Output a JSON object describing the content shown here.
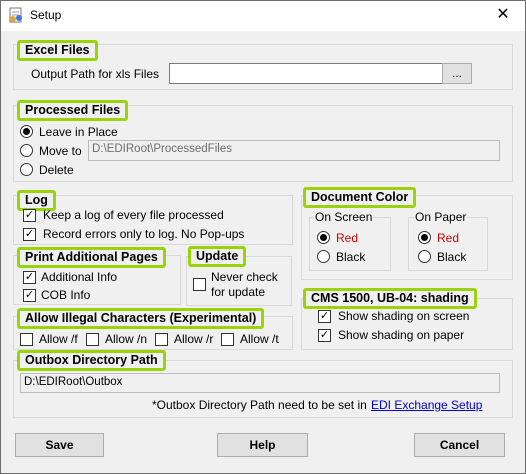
{
  "window": {
    "title": "Setup"
  },
  "excel": {
    "header": "Excel Files",
    "output_label": "Output Path for xls Files",
    "output_value": "",
    "browse_label": "..."
  },
  "processed": {
    "header": "Processed Files",
    "opt_leave": "Leave in Place",
    "opt_move": "Move to",
    "opt_delete": "Delete",
    "selected": "Leave in Place",
    "move_path": "D:\\EDIRoot\\ProcessedFiles"
  },
  "log": {
    "header": "Log",
    "keep_label": "Keep a log of every file processed",
    "keep_checked": true,
    "errors_label": "Record errors only to log. No Pop-ups",
    "errors_checked": true
  },
  "doc_color": {
    "header": "Document Color",
    "screen_header": "On Screen",
    "paper_header": "On Paper",
    "red": "Red",
    "black": "Black",
    "screen_selected": "Red",
    "paper_selected": "Red",
    "red_color": "#d00000"
  },
  "print_pages": {
    "header": "Print Additional Pages",
    "additional_label": "Additional  Info",
    "additional_checked": true,
    "cob_label": "COB Info",
    "cob_checked": true
  },
  "update": {
    "header": "Update",
    "never_label_1": "Never check",
    "never_label_2": "for update",
    "never_checked": false
  },
  "cms": {
    "header": "CMS 1500, UB-04:  shading",
    "screen_label": "Show shading on screen",
    "screen_checked": true,
    "paper_label": "Show shading on paper",
    "paper_checked": true
  },
  "illegal": {
    "header": "Allow Illegal Characters (Experimental)",
    "items": [
      {
        "label": "Allow /f",
        "checked": false
      },
      {
        "label": "Allow /n",
        "checked": false
      },
      {
        "label": "Allow /r",
        "checked": false
      },
      {
        "label": "Allow /t",
        "checked": false
      }
    ]
  },
  "outbox": {
    "header": "Outbox Directory Path",
    "path": "D:\\EDIRoot\\Outbox",
    "note": "*Outbox Directory Path need to be set in",
    "link": "EDI Exchange Setup"
  },
  "buttons": {
    "save": "Save",
    "help": "Help",
    "cancel": "Cancel"
  },
  "colors": {
    "highlight": "#9ad30b",
    "link": "#0000cc"
  }
}
